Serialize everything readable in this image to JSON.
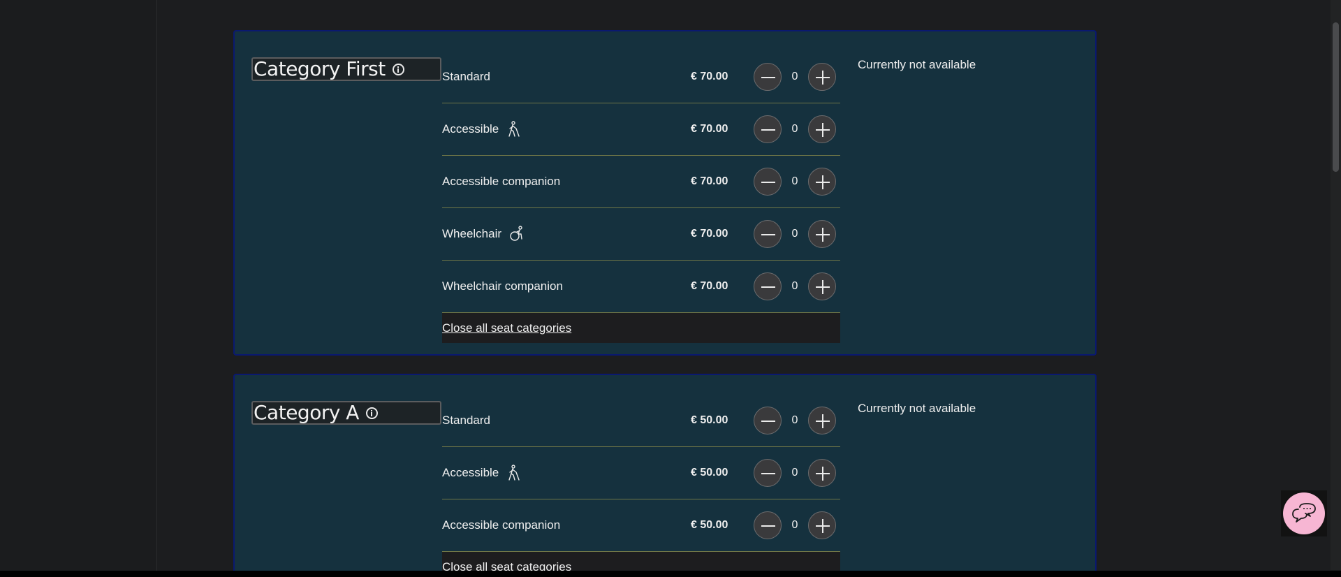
{
  "categories": [
    {
      "title": "Category First",
      "availability": "Currently not available",
      "close_label": "Close all seat categories",
      "rows": [
        {
          "label": "Standard",
          "icon": "",
          "price": "€ 70.00",
          "count": "0"
        },
        {
          "label": "Accessible",
          "icon": "visually-impaired-icon",
          "price": "€ 70.00",
          "count": "0"
        },
        {
          "label": "Accessible companion",
          "icon": "",
          "price": "€ 70.00",
          "count": "0"
        },
        {
          "label": "Wheelchair",
          "icon": "wheelchair-icon",
          "price": "€ 70.00",
          "count": "0"
        },
        {
          "label": "Wheelchair companion",
          "icon": "",
          "price": "€ 70.00",
          "count": "0"
        }
      ]
    },
    {
      "title": "Category A",
      "availability": "Currently not available",
      "close_label": "Close all seat categories",
      "rows": [
        {
          "label": "Standard",
          "icon": "",
          "price": "€ 50.00",
          "count": "0"
        },
        {
          "label": "Accessible",
          "icon": "visually-impaired-icon",
          "price": "€ 50.00",
          "count": "0"
        },
        {
          "label": "Accessible companion",
          "icon": "",
          "price": "€ 50.00",
          "count": "0"
        }
      ]
    }
  ],
  "chat": {
    "icon": "chat-bubble-icon"
  },
  "colors": {
    "card_bg": "#15313e",
    "card_border": "#0a1970",
    "page_bg": "#1b1c1d",
    "chat_bg": "#f7b6d3",
    "row_divider": "#6f7647"
  }
}
